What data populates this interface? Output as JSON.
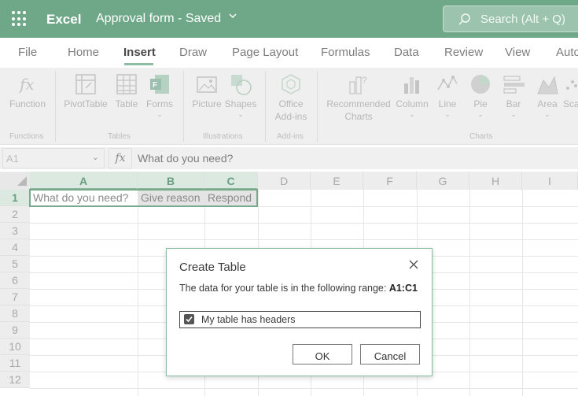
{
  "titlebar": {
    "app_name": "Excel",
    "doc_title": "Approval form  -  Saved",
    "search_placeholder": "Search (Alt + Q)"
  },
  "tabs": [
    "File",
    "Home",
    "Insert",
    "Draw",
    "Page Layout",
    "Formulas",
    "Data",
    "Review",
    "View",
    "Auto"
  ],
  "active_tab": "Insert",
  "ribbon": {
    "buttons": {
      "function": "Function",
      "pivot": "PivotTable",
      "table": "Table",
      "forms": "Forms",
      "picture": "Picture",
      "shapes": "Shapes",
      "addins_1": "Office",
      "addins_2": "Add-ins",
      "recommended_1": "Recommended",
      "recommended_2": "Charts",
      "column": "Column",
      "line": "Line",
      "pie": "Pie",
      "bar": "Bar",
      "area": "Area",
      "scatter": "Sca"
    },
    "groups": {
      "functions": "Functions",
      "tables": "Tables",
      "illustrations": "Illustrations",
      "addins": "Add-ins",
      "charts": "Charts"
    }
  },
  "formula_bar": {
    "name_box": "A1",
    "fx": "fx",
    "formula": "What do you need?"
  },
  "grid": {
    "columns": [
      "A",
      "B",
      "C",
      "D",
      "E",
      "F",
      "G",
      "H",
      "I"
    ],
    "rows": [
      "1",
      "2",
      "3",
      "4",
      "5",
      "6",
      "7",
      "8",
      "9",
      "10",
      "11",
      "12"
    ],
    "row1": {
      "a": "What do you need?",
      "b": "Give reason",
      "c": "Respond"
    }
  },
  "dialog": {
    "title": "Create Table",
    "range_text": "The data for your table is in the following range: ",
    "range_value": "A1:C1",
    "checkbox_label": "My table has headers",
    "checkbox_checked": true,
    "ok": "OK",
    "cancel": "Cancel"
  },
  "colors": {
    "brand": "#6fa889",
    "selection_border": "#77a98c"
  }
}
